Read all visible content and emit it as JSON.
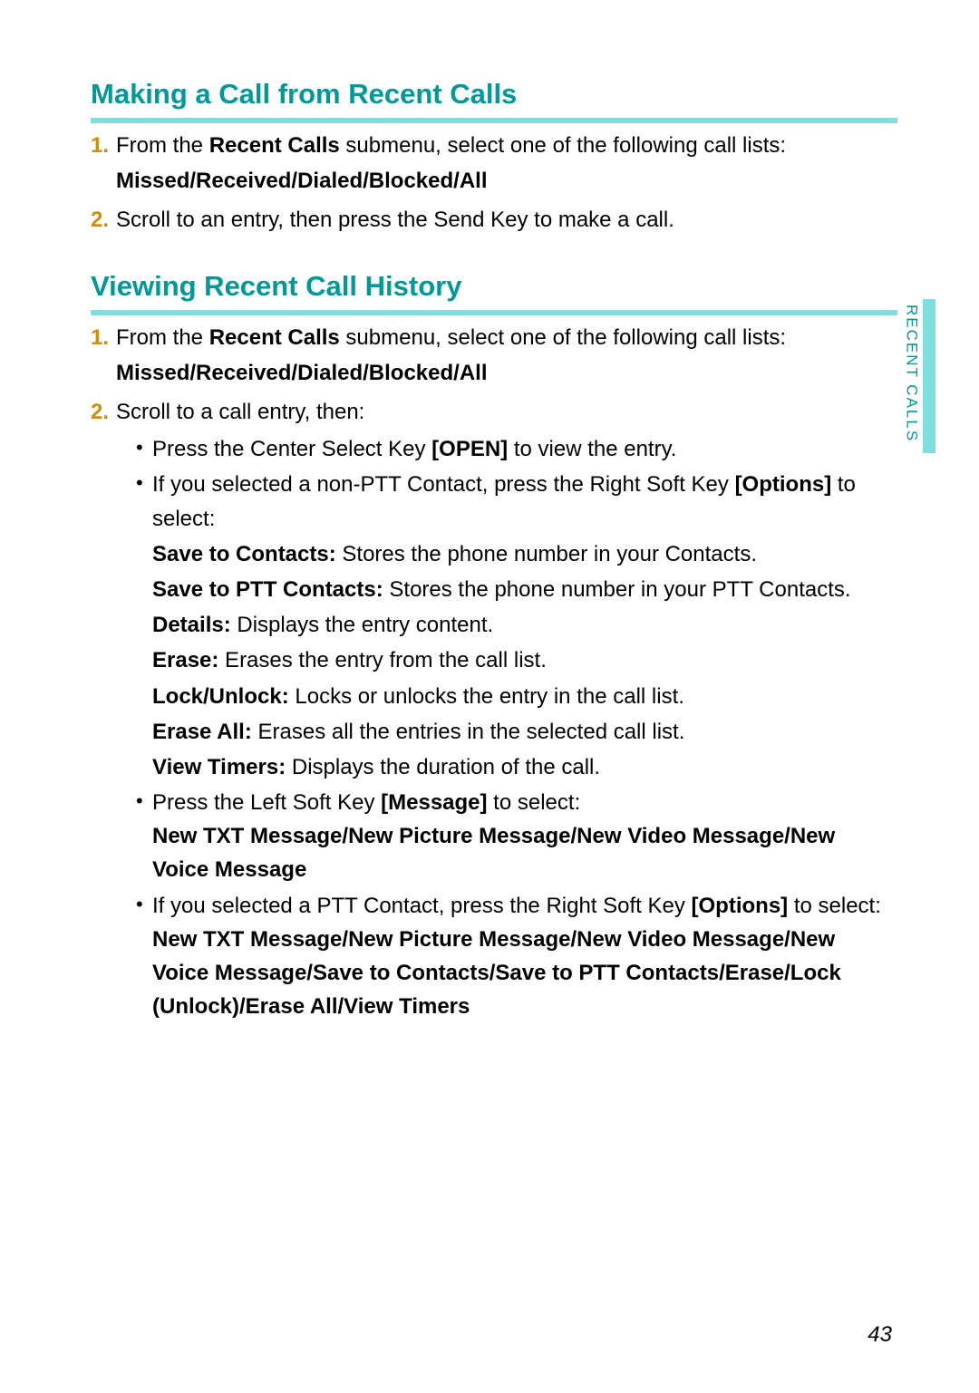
{
  "sideTab": "RECENT CALLS",
  "pageNumber": "43",
  "section1": {
    "heading": "Making a Call from Recent Calls",
    "step1": {
      "pre": "From the ",
      "bold": "Recent Calls",
      "post": " submenu, select one of the following call lists:",
      "sub": "Missed/Received/Dialed/Blocked/All"
    },
    "step2": {
      "text": "Scroll to an entry, then press the Send Key to make a call."
    }
  },
  "section2": {
    "heading": "Viewing Recent Call History",
    "step1": {
      "pre": "From the ",
      "bold": "Recent Calls",
      "post": " submenu, select one of the following call lists:",
      "sub": "Missed/Received/Dialed/Blocked/All"
    },
    "step2": {
      "text": "Scroll to a call entry, then:"
    },
    "bullets": {
      "b1": {
        "pre": "Press the Center Select Key ",
        "key": "[OPEN]",
        "post": " to view the entry."
      },
      "b2": {
        "pre": "If you selected a non-PTT Contact, press the Right Soft Key ",
        "key": "[Options]",
        "post": " to select:",
        "options": [
          {
            "name": "Save to Contacts:",
            "desc": " Stores the phone number in your Contacts."
          },
          {
            "name": "Save to PTT Contacts:",
            "desc": " Stores the phone number in your PTT Contacts."
          },
          {
            "name": "Details:",
            "desc": " Displays the entry content."
          },
          {
            "name": "Erase:",
            "desc": " Erases the entry from the call list."
          },
          {
            "name": "Lock/Unlock:",
            "desc": " Locks or unlocks the entry in the call list."
          },
          {
            "name": "Erase All:",
            "desc": " Erases all the entries in the selected call list."
          },
          {
            "name": "View Timers:",
            "desc": " Displays the duration of the call."
          }
        ]
      },
      "b3": {
        "pre": "Press the Left Soft Key ",
        "key": "[Message]",
        "post": " to select:",
        "multi": "New TXT Message/New Picture Message/New Video Message/New Voice Message"
      },
      "b4": {
        "pre": "If you selected a PTT Contact, press the Right Soft Key ",
        "key": "[Options]",
        "post": " to select:",
        "multi": "New TXT Message/New Picture Message/New Video Message/New Voice Message/Save to Contacts/Save to PTT Contacts/Erase/Lock (Unlock)/Erase All/View Timers"
      }
    }
  }
}
